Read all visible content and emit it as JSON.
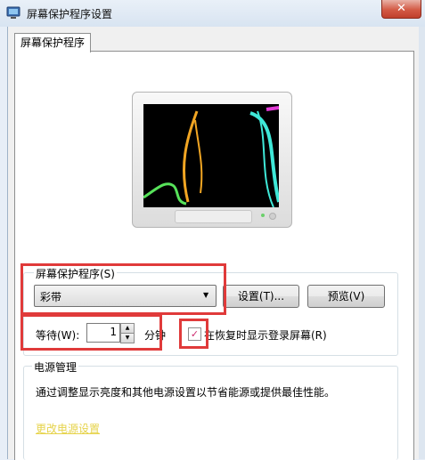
{
  "window": {
    "title": "屏幕保护程序设置",
    "close_glyph": "✕"
  },
  "tabs": [
    {
      "label": "屏幕保护程序"
    }
  ],
  "screensaver": {
    "group_label": "屏幕保护程序(S)",
    "selected": "彩带",
    "settings_button": "设置(T)...",
    "preview_button": "预览(V)",
    "wait_label": "等待(W):",
    "wait_value": "1",
    "wait_unit": "分钟",
    "resume_label": "在恢复时显示登录屏幕(R)",
    "resume_checked": true
  },
  "power": {
    "group_label": "电源管理",
    "description": "通过调整显示亮度和其他电源设置以节省能源或提供最佳性能。",
    "link": "更改电源设置"
  },
  "colors": {
    "highlight": "#e03a3a",
    "ribbon_yellow": "#f2a623",
    "ribbon_cyan": "#3fe8d8",
    "ribbon_green": "#57e25a",
    "ribbon_magenta": "#e23bd6"
  },
  "icons": {
    "close": "close-icon",
    "dropdown": "chevron-down-icon",
    "spin_up": "triangle-up-icon",
    "spin_down": "triangle-down-icon",
    "checkbox": "checkmark-icon"
  }
}
